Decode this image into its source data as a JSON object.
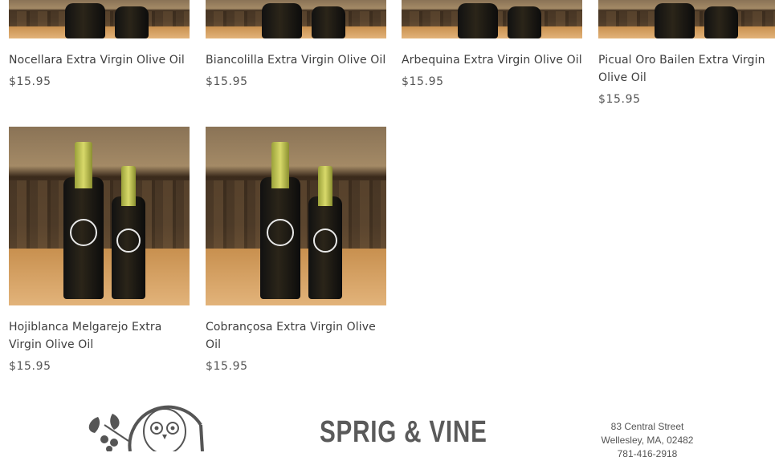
{
  "products": [
    {
      "name": "Nocellara Extra Virgin Olive Oil",
      "price": "$15.95"
    },
    {
      "name": "Biancolilla Extra Virgin Olive Oil",
      "price": "$15.95"
    },
    {
      "name": "Arbequina Extra Virgin Olive Oil",
      "price": "$15.95"
    },
    {
      "name": "Picual Oro Bailen Extra Virgin Olive Oil",
      "price": "$15.95"
    },
    {
      "name": "Hojiblanca Melgarejo Extra Virgin Olive Oil",
      "price": "$15.95"
    },
    {
      "name": "Cobrançosa Extra Virgin Olive Oil",
      "price": "$15.95"
    }
  ],
  "footer": {
    "brand": "SPRIG & VINE",
    "address_line1": "83 Central Street",
    "address_line2": "Wellesley, MA, 02482",
    "address_line3": "781-416-2918"
  }
}
